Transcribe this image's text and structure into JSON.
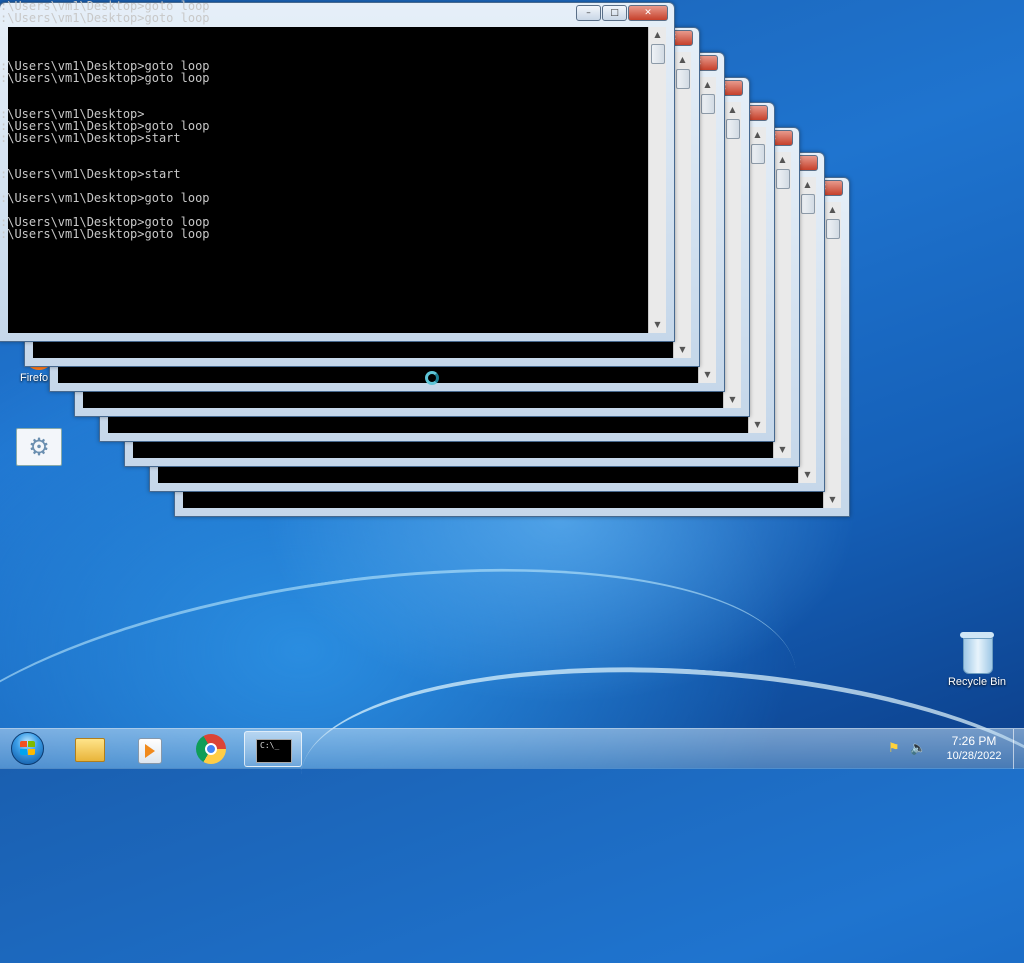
{
  "desktop": {
    "icons": {
      "firefox": {
        "label": "Firefo"
      },
      "recycle_bin": {
        "label": "Recycle Bin"
      }
    }
  },
  "console": {
    "lines": [
      ":\\Users\\vm1\\Desktop>goto loop",
      ":\\Users\\vm1\\Desktop>goto loop",
      "",
      "",
      "",
      ":\\Users\\vm1\\Desktop>goto loop",
      ":\\Users\\vm1\\Desktop>goto loop",
      "",
      "",
      ":\\Users\\vm1\\Desktop>",
      ":\\Users\\vm1\\Desktop>goto loop",
      ":\\Users\\vm1\\Desktop>start",
      "",
      "",
      ":\\Users\\vm1\\Desktop>start",
      "",
      ":\\Users\\vm1\\Desktop>goto loop",
      "",
      ":\\Users\\vm1\\Desktop>goto loop",
      ":\\Users\\vm1\\Desktop>goto loop"
    ],
    "window_count": 8
  },
  "taskbar": {
    "start_icon": "windows-orb-icon",
    "pinned": [
      "file-explorer-icon",
      "media-player-icon",
      "chrome-icon",
      "command-prompt-icon"
    ],
    "cmd_thumb_text": "C:\\_",
    "tray": {
      "icons": [
        "action-center-flag-icon",
        "volume-icon"
      ],
      "time": "7:26 PM",
      "date": "10/28/2022"
    }
  },
  "colors": {
    "desktop_blue": "#1f74cf",
    "console_bg": "#000000",
    "console_text": "#c8c8c8",
    "close_red": "#c6402a"
  }
}
